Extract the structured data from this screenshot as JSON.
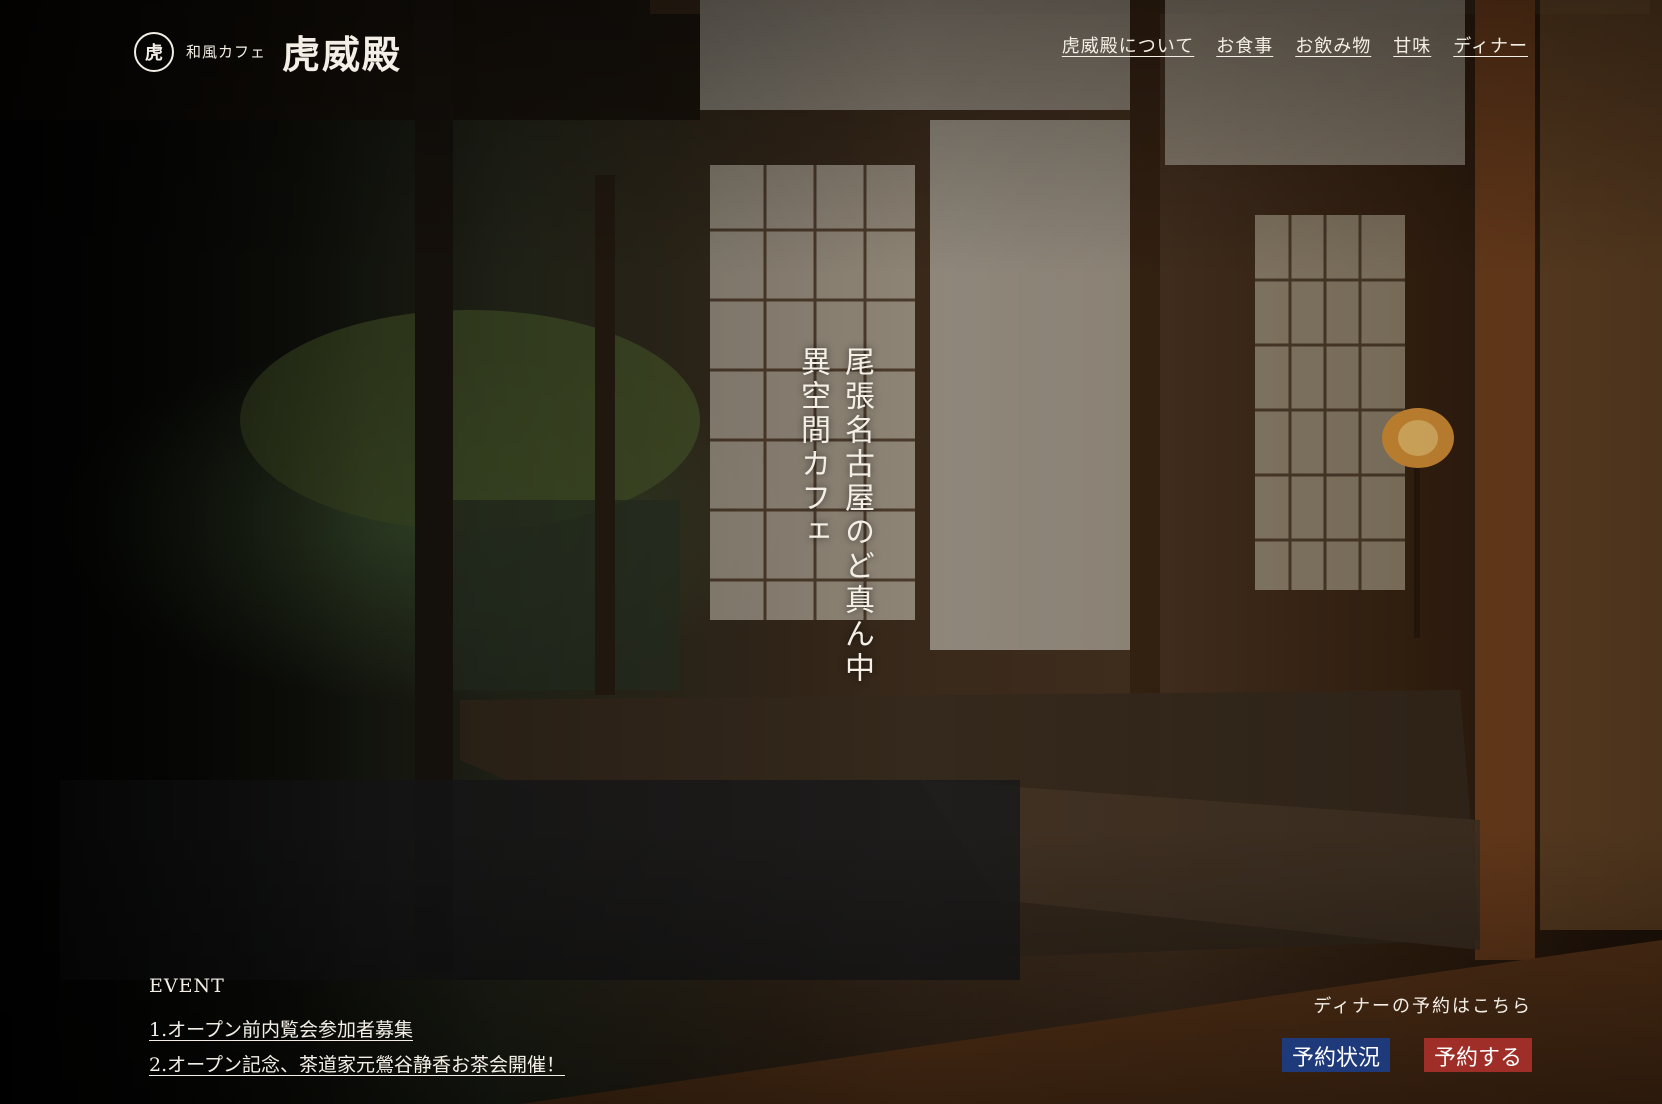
{
  "brand": {
    "mark": "虎",
    "subtitle": "和風カフェ",
    "name": "虎威殿"
  },
  "nav": {
    "items": [
      {
        "label": "虎威殿について"
      },
      {
        "label": "お食事"
      },
      {
        "label": "お飲み物"
      },
      {
        "label": "甘味"
      },
      {
        "label": "ディナー"
      }
    ]
  },
  "hero": {
    "tagline_line1": "尾張名古屋のど真ん中",
    "tagline_line2": "異空間カフェ"
  },
  "event": {
    "title": "EVENT",
    "items": [
      {
        "label": "1.オープン前内覧会参加者募集"
      },
      {
        "label": "2.オープン記念、茶道家元鶯谷静香お茶会開催！"
      }
    ]
  },
  "reservation": {
    "label": "ディナーの予約はこちら",
    "status_button": "予約状況",
    "book_button": "予約する"
  },
  "colors": {
    "status_button": "#1f3a7a",
    "book_button": "#9e2e27",
    "text": "#f3efe6"
  }
}
